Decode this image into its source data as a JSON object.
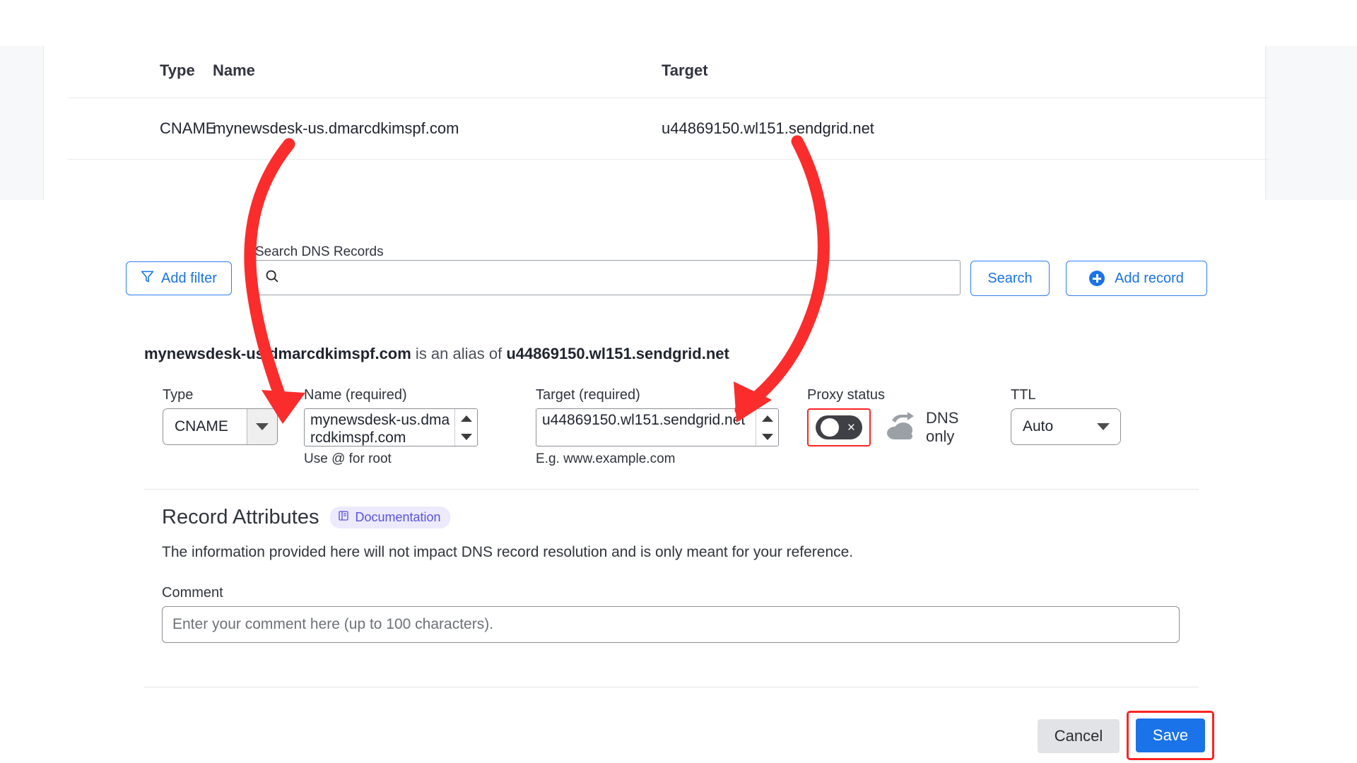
{
  "records_table": {
    "columns": [
      "Type",
      "Name",
      "Target"
    ],
    "rows": [
      {
        "type": "CNAME",
        "name": "mynewsdesk-us.dmarcdkimspf.com",
        "target": "u44869150.wl151.sendgrid.net"
      }
    ]
  },
  "toolbar": {
    "add_filter_label": "Add filter",
    "filter_icon": "funnel-icon",
    "search_label": "Search DNS Records",
    "search_icon": "search-icon",
    "search_value": "",
    "search_placeholder": "",
    "search_button_label": "Search",
    "add_record_label": "Add record",
    "add_record_icon": "plus-circle-icon"
  },
  "alias": {
    "name": "mynewsdesk-us.dmarcdkimspf.com",
    "middle": " is an alias of ",
    "target": "u44869150.wl151.sendgrid.net"
  },
  "form": {
    "type": {
      "label": "Type",
      "value": "CNAME",
      "caret_icon": "caret-down-icon"
    },
    "name": {
      "label": "Name (required)",
      "value": "mynewsdesk-us.dmarcdkimspf.com",
      "hint": "Use @ for root",
      "spinner_up_icon": "triangle-up-icon",
      "spinner_down_icon": "triangle-down-icon"
    },
    "target": {
      "label": "Target (required)",
      "value": "u44869150.wl151.sendgrid.net",
      "hint": "E.g. www.example.com",
      "spinner_up_icon": "triangle-up-icon",
      "spinner_down_icon": "triangle-down-icon"
    },
    "proxy": {
      "label": "Proxy status",
      "toggle_state": "off",
      "toggle_glyph": "×",
      "cloud_icon": "cloud-arrow-icon",
      "status_text": "DNS only",
      "highlight_color": "#ff2222"
    },
    "ttl": {
      "label": "TTL",
      "value": "Auto",
      "caret_icon": "caret-down-icon"
    }
  },
  "record_attributes": {
    "title": "Record Attributes",
    "documentation_badge": "Documentation",
    "documentation_icon": "book-icon",
    "description": "The information provided here will not impact DNS record resolution and is only meant for your reference.",
    "comment_label": "Comment",
    "comment_value": "",
    "comment_placeholder": "Enter your comment here (up to 100 characters)."
  },
  "footer": {
    "cancel_label": "Cancel",
    "save_label": "Save",
    "save_highlight_color": "#ff2222"
  },
  "colors": {
    "accent_blue": "#1a73e8",
    "annotation_red": "#ff2222",
    "badge_violet": "#5b52e0",
    "panel_gray": "#f6f8fa"
  }
}
